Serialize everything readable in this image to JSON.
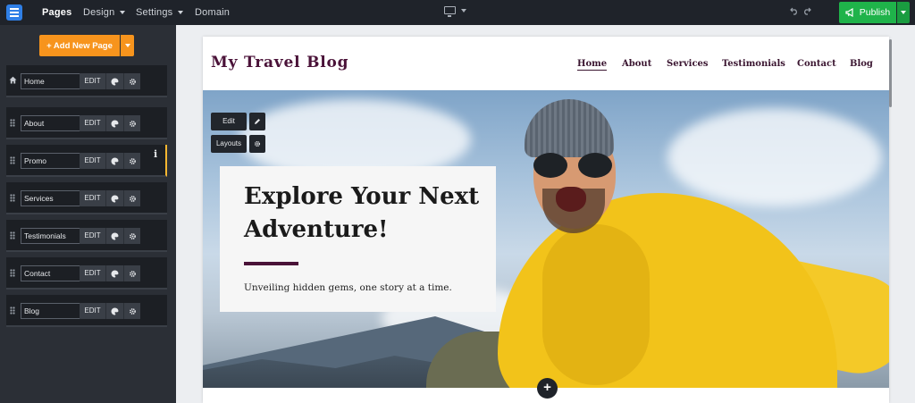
{
  "topbar": {
    "nav": [
      {
        "label": "Pages",
        "active": true,
        "has_menu": false
      },
      {
        "label": "Design",
        "active": false,
        "has_menu": true
      },
      {
        "label": "Settings",
        "active": false,
        "has_menu": true
      },
      {
        "label": "Domain",
        "active": false,
        "has_menu": false
      }
    ],
    "device_icon": "desktop-monitor-icon",
    "publish_label": "Publish"
  },
  "sidebar": {
    "add_page_label": "+ Add New Page",
    "edit_label": "EDIT",
    "pages": [
      {
        "name": "Home",
        "is_home": true
      },
      {
        "name": "About",
        "is_home": false
      },
      {
        "name": "Promo",
        "is_home": false,
        "selected": true
      },
      {
        "name": "Services",
        "is_home": false
      },
      {
        "name": "Testimonials",
        "is_home": false
      },
      {
        "name": "Contact",
        "is_home": false
      },
      {
        "name": "Blog",
        "is_home": false
      }
    ],
    "info_glyph": "i"
  },
  "site": {
    "title": "My Travel Blog",
    "nav": [
      {
        "label": "Home",
        "active": true
      },
      {
        "label": "About",
        "active": false
      },
      {
        "label": "Services",
        "active": false
      },
      {
        "label": "Testimonials",
        "active": false
      },
      {
        "label": "Contact",
        "active": false
      },
      {
        "label": "Blog",
        "active": false
      }
    ],
    "hero": {
      "title": "Explore Your Next Adventure!",
      "subtitle": "Unveiling hidden gems, one story at a time.",
      "edit_label": "Edit",
      "layouts_label": "Layouts"
    },
    "add_section_glyph": "+"
  },
  "colors": {
    "accent_orange": "#f7941d",
    "publish_green": "#1fb34a",
    "brand_plum": "#4a1238",
    "topbar_bg": "#1f232a"
  }
}
